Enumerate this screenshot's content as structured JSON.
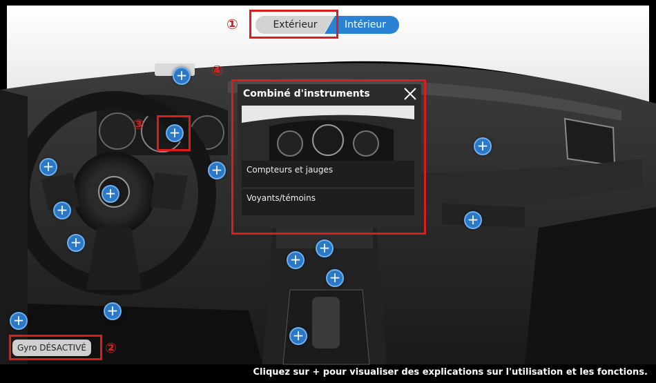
{
  "view_toggle": {
    "exterior_label": "Extérieur",
    "interior_label": "Intérieur"
  },
  "markers": {
    "m1": "①",
    "m2": "②",
    "m3": "③",
    "m4": "④"
  },
  "panel": {
    "title": "Combiné d'instruments",
    "items": [
      {
        "label": "Compteurs et jauges"
      },
      {
        "label": "Voyants/témoins"
      }
    ]
  },
  "gyro_button": {
    "label": "Gyro DÉSACTIVÉ"
  },
  "footer": {
    "instruction": "Cliquez sur + pour visualiser des explications sur l'utilisation et les fonctions."
  },
  "hotspot_symbol": "+",
  "colors": {
    "accent": "#2a82d4",
    "annotation_red": "#e01b1b",
    "panel_bg": "#2b2b2b"
  }
}
